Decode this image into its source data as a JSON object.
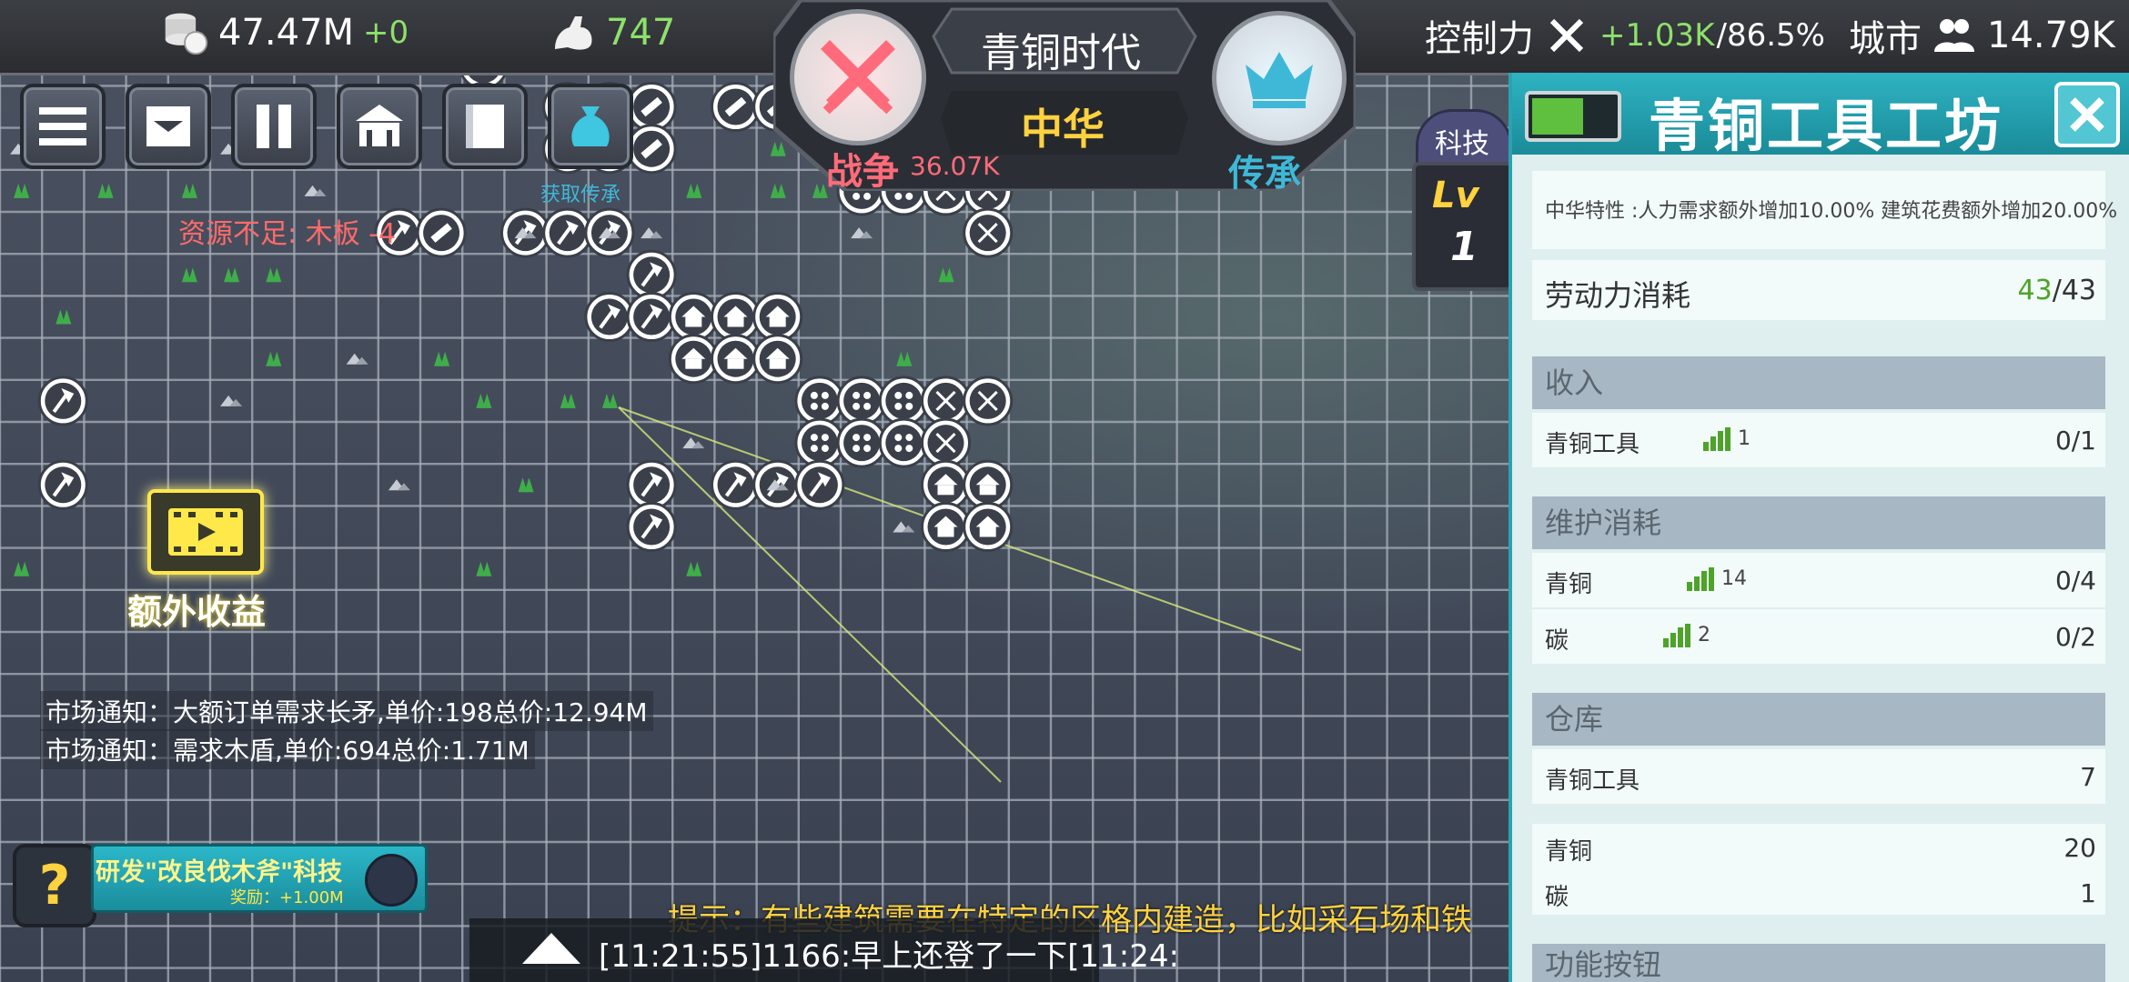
{
  "topbar": {
    "gold_value": "47.47M",
    "gold_delta": "+0",
    "power_value": "747",
    "control_label": "控制力",
    "control_delta": "+1.03K",
    "control_pct": "/86.5%",
    "city_label": "城市",
    "city_value": "14.79K"
  },
  "center": {
    "era": "青铜时代",
    "civ": "中华",
    "war_label": "战争",
    "war_value": "36.07K",
    "inherit_label": "传承"
  },
  "tech": {
    "label": "科技",
    "lv": "Lv",
    "level": "1"
  },
  "toolbar": {
    "get_inherit": "获取传承"
  },
  "map": {
    "warning": "资源不足: 木板 -4",
    "bonus_label": "额外收益",
    "market_1": "市场通知：大额订单需求长矛,单价:198总价:12.94M",
    "market_2": "市场通知：需求木盾,单价:694总价:1.71M",
    "research": "研发\"改良伐木斧\"科技",
    "reward": "奖励：+1.00M",
    "hint": "提示：有些建筑需要在特定的区格内建造，比如采石场和铁",
    "chat": "[11:21:55]1166:早上还登了一下[11:24:"
  },
  "panel": {
    "title": "青铜工具工坊",
    "trait": "中华特性 :人力需求额外增加10.00% 建筑花费额外增加20.00%",
    "labor_label": "劳动力消耗",
    "labor_used": "43",
    "labor_total": "/43",
    "income_title": "收入",
    "income_item": "青铜工具",
    "income_count": "1",
    "income_value": "0/1",
    "upkeep_title": "维护消耗",
    "upkeep_1_name": "青铜",
    "upkeep_1_count": "14",
    "upkeep_1_value": "0/4",
    "upkeep_2_name": "碳",
    "upkeep_2_count": "2",
    "upkeep_2_value": "0/2",
    "storage_title": "仓库",
    "storage_1_name": "青铜工具",
    "storage_1_value": "7",
    "storage_2_name": "青铜",
    "storage_2_value": "20",
    "storage_3_name": "碳",
    "storage_3_value": "1",
    "more_title": "功能按钮"
  },
  "colors": {
    "accent_teal": "#2aa3b1",
    "war_red": "#ff6b7a",
    "inherit_blue": "#3fb8d8",
    "gold": "#ffd23f",
    "green": "#8ee06a"
  }
}
